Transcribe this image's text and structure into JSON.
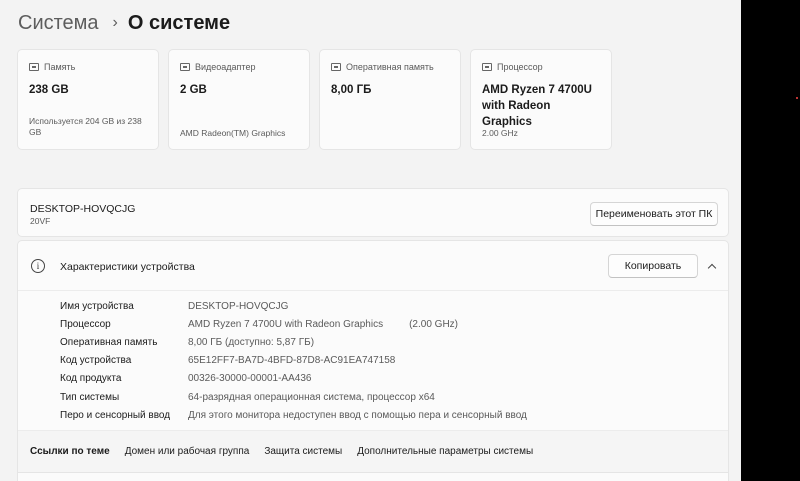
{
  "breadcrumb": {
    "parent": "Система",
    "separator": "›",
    "current": "О системе"
  },
  "cards": [
    {
      "icon": "storage-icon",
      "label": "Память",
      "value": "238 GB",
      "sub": "Используется 204 GB из 238 GB"
    },
    {
      "icon": "display-adapter-icon",
      "label": "Видеоадаптер",
      "value": "2 GB",
      "sub": "AMD Radeon(TM) Graphics"
    },
    {
      "icon": "memory-icon",
      "label": "Оперативная память",
      "value": "8,00 ГБ",
      "sub": ""
    },
    {
      "icon": "processor-icon",
      "label": "Процессор",
      "value": "AMD Ryzen 7 4700U with Radeon Graphics",
      "sub": "2.00 GHz"
    }
  ],
  "pc": {
    "name": "DESKTOP-HOVQCJG",
    "model": "20VF",
    "rename_button": "Переименовать этот ПК"
  },
  "specs": {
    "title": "Характеристики устройства",
    "copy_button": "Копировать",
    "rows": [
      {
        "label": "Имя устройства",
        "value": "DESKTOP-HOVQCJG",
        "extra": ""
      },
      {
        "label": "Процессор",
        "value": "AMD Ryzen 7 4700U with Radeon Graphics",
        "extra": "(2.00 GHz)"
      },
      {
        "label": "Оперативная память",
        "value": "8,00 ГБ (доступно: 5,87 ГБ)",
        "extra": ""
      },
      {
        "label": "Код устройства",
        "value": "65E12FF7-BA7D-4BFD-87D8-AC91EA747158",
        "extra": ""
      },
      {
        "label": "Код продукта",
        "value": "00326-30000-00001-AA436",
        "extra": ""
      },
      {
        "label": "Тип системы",
        "value": "64-разрядная операционная система, процессор x64",
        "extra": ""
      },
      {
        "label": "Перо и сенсорный ввод",
        "value": "Для этого монитора недоступен ввод с помощью пера и сенсорный ввод",
        "extra": ""
      }
    ]
  },
  "related_links": {
    "title": "Ссылки по теме",
    "items": [
      "Домен или рабочая группа",
      "Защита системы",
      "Дополнительные параметры системы"
    ]
  }
}
